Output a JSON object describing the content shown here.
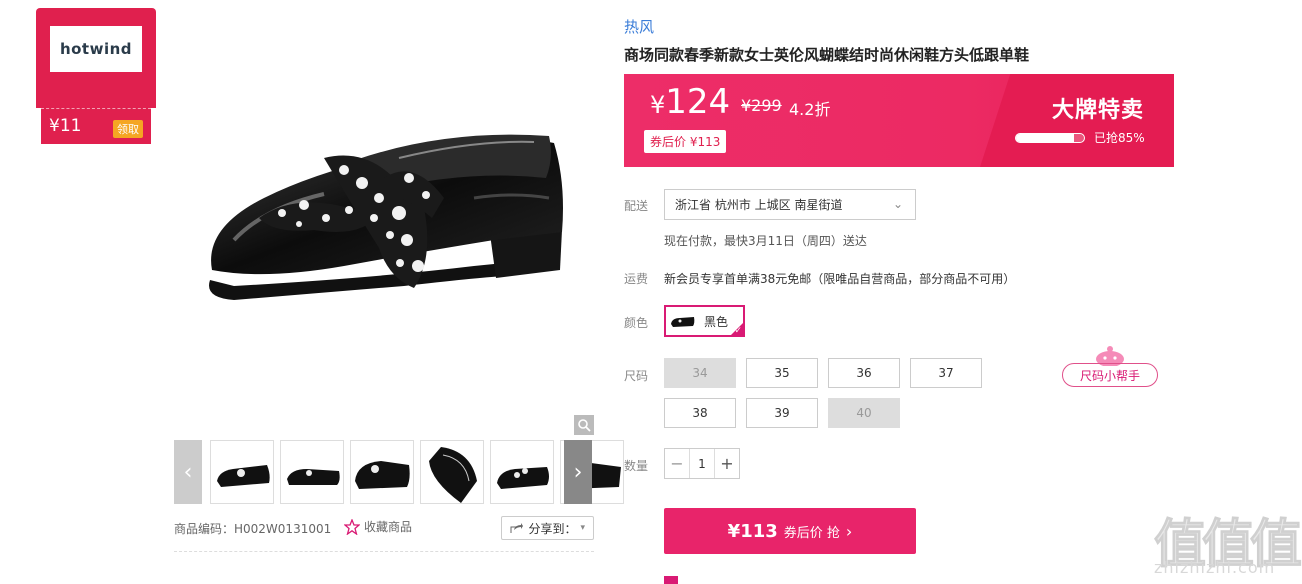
{
  "coupon": {
    "logo": "hotwind",
    "amount": "¥11",
    "button": "领取"
  },
  "gallery": {
    "prev_icon": "chevron-left-icon",
    "next_icon": "chevron-right-icon",
    "thumbnail_count": 6
  },
  "meta": {
    "sku": "商品编码：H002W0131001",
    "favorite": "收藏商品",
    "share": "分享到："
  },
  "product": {
    "brand": "热风",
    "title": "商场同款春季新款女士英伦风蝴蝶结时尚休闲鞋方头低跟单鞋"
  },
  "price": {
    "symbol": "¥",
    "current": "124",
    "original": "¥299",
    "discount": "4.2折",
    "after_coupon": "券后价 ¥113",
    "promo_title": "大牌特卖",
    "sold_percent": 85,
    "sold_text": "已抢85%"
  },
  "shipping": {
    "label": "配送",
    "address": "浙江省 杭州市 上城区 南星街道",
    "eta": "现在付款，最快3月11日（周四）送达"
  },
  "freight": {
    "label": "运费",
    "text": "新会员专享首单满38元免邮（限唯品自营商品，部分商品不可用）"
  },
  "color": {
    "label": "颜色",
    "selected": "黑色"
  },
  "sizes": {
    "label": "尺码",
    "options": [
      {
        "value": "34",
        "available": false
      },
      {
        "value": "35",
        "available": true
      },
      {
        "value": "36",
        "available": true
      },
      {
        "value": "37",
        "available": true
      },
      {
        "value": "38",
        "available": true
      },
      {
        "value": "39",
        "available": true
      },
      {
        "value": "40",
        "available": false
      }
    ],
    "helper": "尺码小帮手"
  },
  "quantity": {
    "label": "数量",
    "value": "1",
    "minus": "−",
    "plus": "+"
  },
  "buy_button": {
    "amount": "¥113",
    "text": "券后价 抢"
  },
  "watermark": {
    "big": "值值值",
    "small": "zhizhizhi.com"
  },
  "colors": {
    "accent": "#e8246a",
    "brand_link": "#3b7dd8",
    "price_bar": "#ec2a63"
  }
}
